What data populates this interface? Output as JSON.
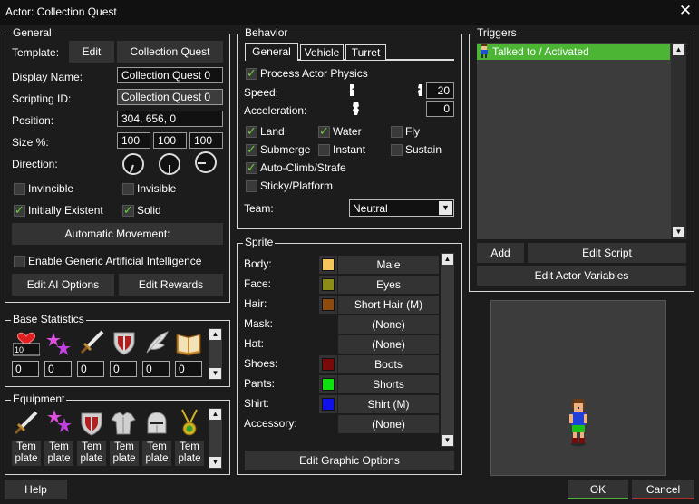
{
  "window": {
    "title": "Actor: Collection Quest",
    "close_glyph": "✕"
  },
  "general": {
    "title": "General",
    "template_label": "Template:",
    "template_edit": "Edit",
    "template_value": "Collection Quest",
    "display_name_label": "Display Name:",
    "display_name_value": "Collection Quest 0",
    "scripting_id_label": "Scripting ID:",
    "scripting_id_value": "Collection Quest 0",
    "position_label": "Position:",
    "position_value": "304, 656, 0",
    "size_label": "Size %:",
    "size_values": [
      "100",
      "100",
      "100"
    ],
    "direction_label": "Direction:",
    "invincible": "Invincible",
    "invisible": "Invisible",
    "initially_existent": "Initially Existent",
    "solid": "Solid",
    "automatic_movement": "Automatic Movement:",
    "enable_ai": "Enable Generic Artificial Intelligence",
    "edit_ai_options": "Edit AI Options",
    "edit_rewards": "Edit Rewards"
  },
  "base_stats": {
    "title": "Base Statistics",
    "heart_badge": "10",
    "icons": [
      "heart-icon",
      "stars-icon",
      "sword-icon",
      "shield-icon",
      "wing-icon",
      "book-icon"
    ],
    "values": [
      "0",
      "0",
      "0",
      "0",
      "0",
      "0"
    ]
  },
  "equipment": {
    "title": "Equipment",
    "icons": [
      "sword-icon",
      "stars-icon",
      "shield-icon",
      "armor-icon",
      "helmet-icon",
      "amulet-icon"
    ],
    "template_label_top": "Tem",
    "template_label_bottom": "plate"
  },
  "behavior": {
    "title": "Behavior",
    "tabs": [
      "General",
      "Vehicle",
      "Turret"
    ],
    "process_physics": "Process Actor Physics",
    "speed_label": "Speed:",
    "speed_value": "20",
    "accel_label": "Acceleration:",
    "accel_value": "0",
    "land": "Land",
    "water": "Water",
    "fly": "Fly",
    "submerge": "Submerge",
    "instant": "Instant",
    "sustain": "Sustain",
    "auto_climb": "Auto-Climb/Strafe",
    "sticky": "Sticky/Platform",
    "team_label": "Team:",
    "team_value": "Neutral"
  },
  "sprite": {
    "title": "Sprite",
    "rows": [
      {
        "label": "Body:",
        "value": "Male",
        "color": "#f5c45a"
      },
      {
        "label": "Face:",
        "value": "Eyes",
        "color": "#8c8c18"
      },
      {
        "label": "Hair:",
        "value": "Short Hair (M)",
        "color": "#8c4a10"
      },
      {
        "label": "Mask:",
        "value": "(None)",
        "color": ""
      },
      {
        "label": "Hat:",
        "value": "(None)",
        "color": ""
      },
      {
        "label": "Shoes:",
        "value": "Boots",
        "color": "#7a0a0a"
      },
      {
        "label": "Pants:",
        "value": "Shorts",
        "color": "#10e010"
      },
      {
        "label": "Shirt:",
        "value": "Shirt (M)",
        "color": "#1010e8"
      },
      {
        "label": "Accessory:",
        "value": "(None)",
        "color": ""
      }
    ],
    "edit_graphic": "Edit Graphic Options"
  },
  "triggers": {
    "title": "Triggers",
    "items": [
      "Talked to / Activated"
    ],
    "add": "Add",
    "edit_script": "Edit Script",
    "edit_vars": "Edit Actor Variables"
  },
  "footer": {
    "help": "Help",
    "ok": "OK",
    "cancel": "Cancel"
  },
  "colors": {
    "accent": "#4cb534",
    "check": "#62d03c",
    "bg": "#1c1c1c"
  }
}
